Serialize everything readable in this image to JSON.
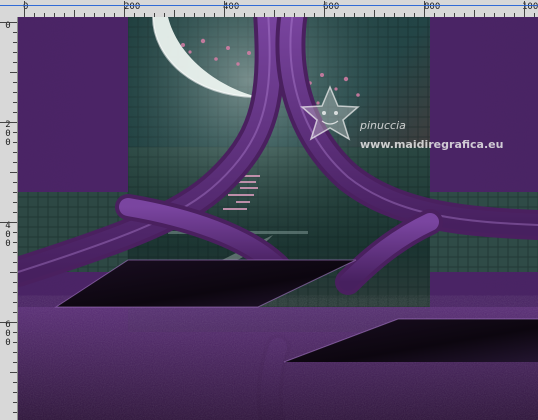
{
  "ruler": {
    "top_labels": [
      "0",
      "200",
      "400",
      "600",
      "800",
      "100"
    ],
    "left_labels": [
      "0",
      "2\n0\n0",
      "4\n0\n0",
      "6\n0\n0"
    ]
  },
  "watermark": {
    "signature": "pinuccia",
    "site": "www.maidiregrafica.eu"
  },
  "colors": {
    "frame_purple": "#5a2a78",
    "frame_purple_dark": "#3a1550",
    "frame_purple_light": "#8a4bb0",
    "teal_dark": "#173235",
    "teal_mid": "#2f4d48",
    "ruler_bg": "#d8d8d8",
    "selection_blue": "#1f5fd6"
  },
  "icons": {
    "star_logo": "star-character-logo"
  }
}
